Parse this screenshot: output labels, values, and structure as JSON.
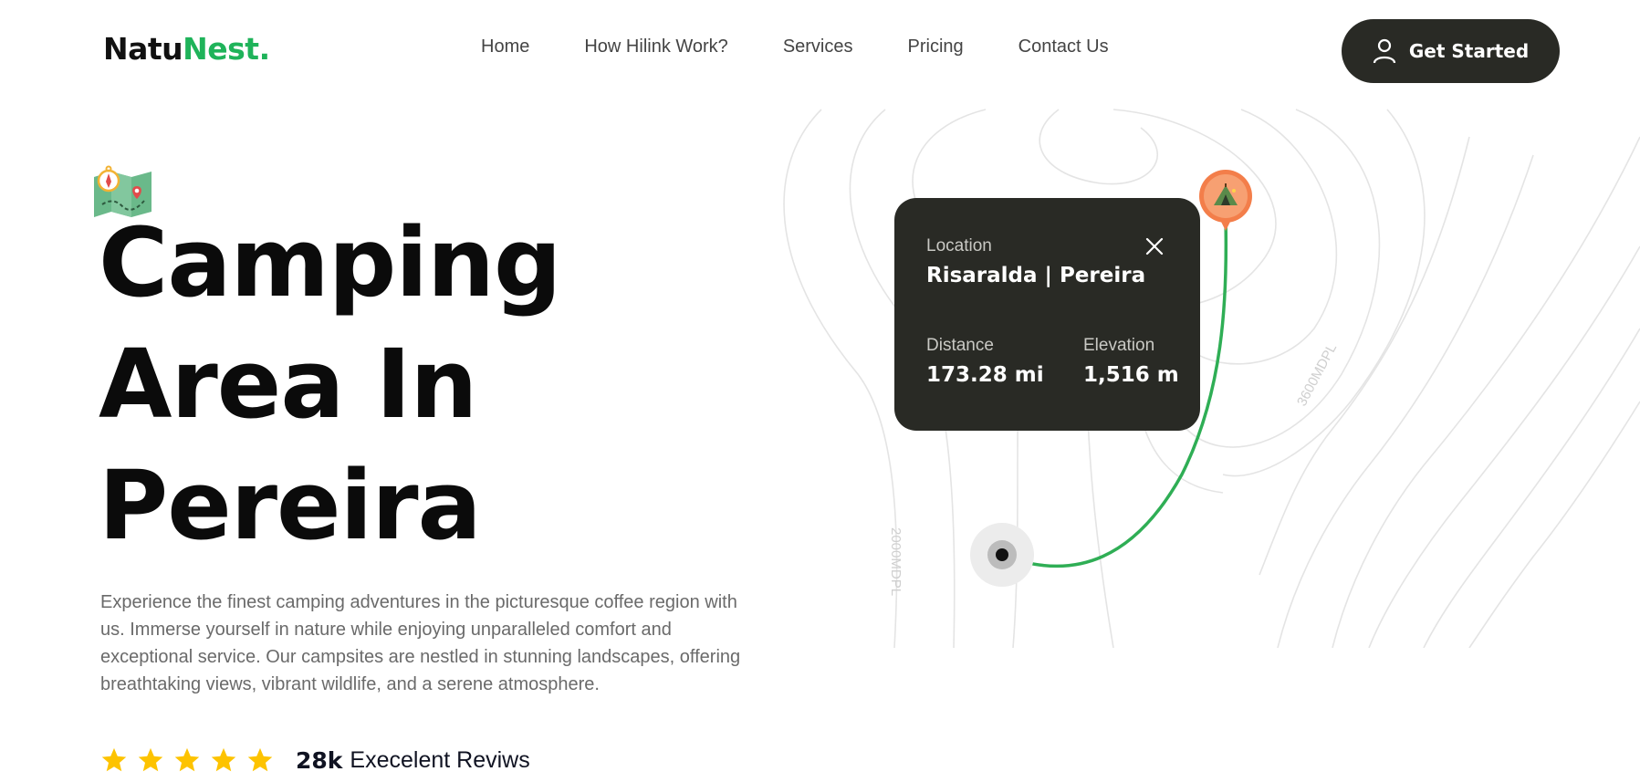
{
  "header": {
    "logo_part1": "Natu",
    "logo_part2": "Nest.",
    "nav": [
      {
        "label": "Home"
      },
      {
        "label": "How Hilink Work?"
      },
      {
        "label": "Services"
      },
      {
        "label": "Pricing"
      },
      {
        "label": "Contact Us"
      }
    ],
    "cta_label": "Get Started",
    "cta_icon": "user-icon"
  },
  "hero": {
    "title_lines": [
      "Camping",
      "Area In",
      "Pereira"
    ],
    "sticker_icon": "folded-map-icon",
    "description": "Experience the finest camping adventures in the picturesque coffee region with us. Immerse yourself in nature while enjoying unparalleled comfort and exceptional service. Our campsites are nestled in stunning landscapes, offering breathtaking views, vibrant wildlife, and a serene atmosphere.",
    "rating": {
      "stars": 5,
      "count": "28k",
      "label": "Execelent Reviws"
    }
  },
  "map_card": {
    "location_label": "Location",
    "location_value": "Risaralda | Pereira",
    "distance_label": "Distance",
    "distance_value": "173.28 mi",
    "elevation_label": "Elevation",
    "elevation_value": "1,516 m",
    "close_icon": "close-icon"
  },
  "map": {
    "contour_labels": [
      "2000MDPL",
      "3600MDPL"
    ],
    "route_color": "#2fae55",
    "destination_pin_color": "#f37e4a",
    "destination_icon": "tent-icon",
    "origin_icon": "origin-marker-icon"
  },
  "colors": {
    "brand_dark": "#292a25",
    "brand_green": "#1fb35a",
    "star": "#fdc300"
  }
}
